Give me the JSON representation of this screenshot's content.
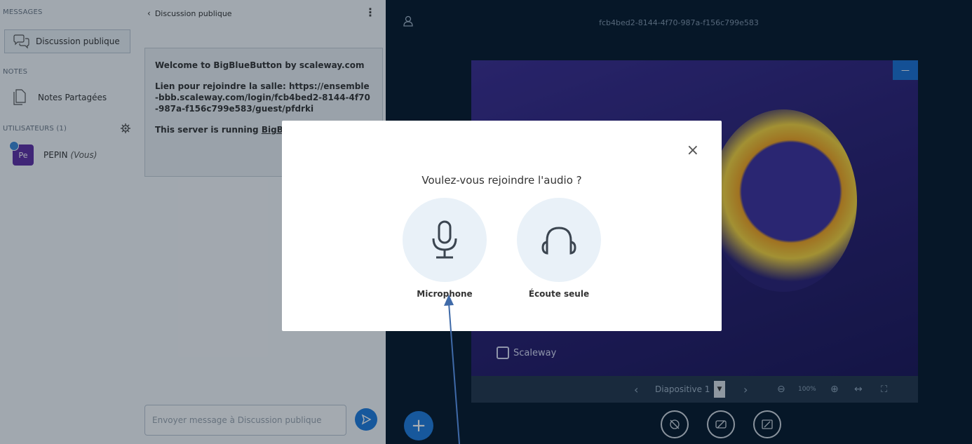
{
  "userlist": {
    "messages_title": "MESSAGES",
    "chat_label": "Discussion publique",
    "notes_title": "NOTES",
    "notes_label": "Notes Partagées",
    "users_title": "UTILISATEURS (1)",
    "user_initials": "Pe",
    "user_name": "PEPIN",
    "user_you": "(Vous)"
  },
  "chat": {
    "header": "Discussion publique",
    "welcome_line1": "Welcome to BigBlueButton by scaleway.com",
    "welcome_line2": "Lien pour rejoindre la salle: https://ensemble-bbb.scaleway.com/login/fcb4bed2-8144-4f70-987a-f156c799e583/guest/pfdrki",
    "welcome_line3_prefix": "This server is running ",
    "welcome_line3_link": "BigBl",
    "input_placeholder": "Envoyer message à Discussion publique"
  },
  "main": {
    "meeting_title": "fcb4bed2-8144-4f70-987a-f156c799e583",
    "slide_logo": "Scaleway",
    "slide_label": "Diapositive 1",
    "zoom": "100%",
    "minimize": "—"
  },
  "modal": {
    "question": "Voulez-vous rejoindre l'audio ?",
    "microphone_label": "Microphone",
    "listen_label": "Écoute seule",
    "close": "×"
  },
  "colors": {
    "accent": "#1f7bdc",
    "background": "#06172a",
    "avatar": "#5e2fa3"
  }
}
